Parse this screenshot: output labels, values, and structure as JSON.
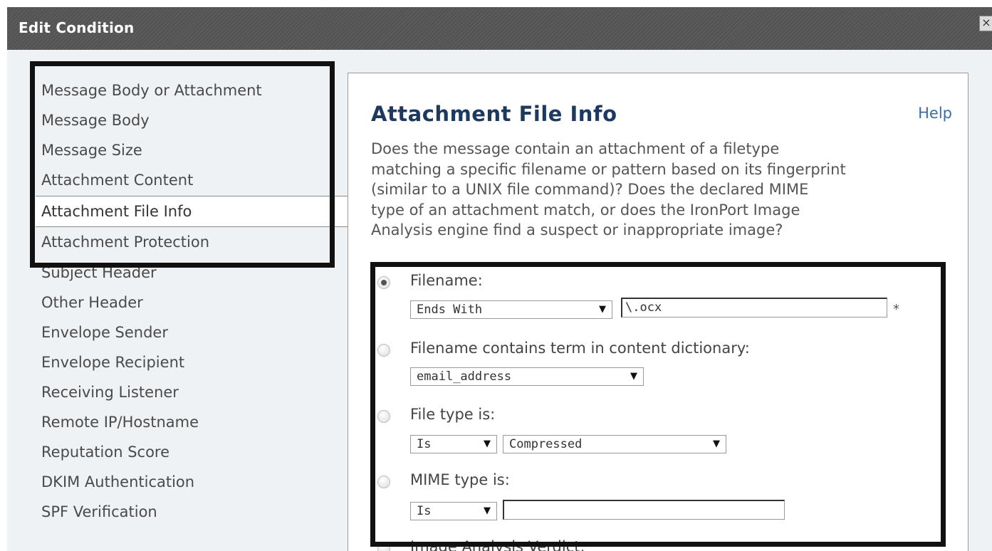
{
  "dialog": {
    "title": "Edit Condition",
    "close_label": "×"
  },
  "conditions": [
    "Message Body or Attachment",
    "Message Body",
    "Message Size",
    "Attachment Content",
    "Attachment File Info",
    "Attachment Protection",
    "Subject Header",
    "Other Header",
    "Envelope Sender",
    "Envelope Recipient",
    "Receiving Listener",
    "Remote IP/Hostname",
    "Reputation Score",
    "DKIM Authentication",
    "SPF Verification"
  ],
  "selected_condition": "Attachment File Info",
  "panel": {
    "title": "Attachment File Info",
    "help": "Help",
    "description_lines": [
      "Does the message contain an attachment of a filetype",
      "matching a specific filename or pattern based on its fingerprint",
      "(similar to a UNIX file command)? Does the declared MIME",
      "type of an attachment match, or does the IronPort Image",
      "Analysis engine find a suspect or inappropriate image?"
    ],
    "options": {
      "filename": {
        "label": "Filename:",
        "operator": "Ends With",
        "value": "\\.ocx",
        "required_mark": "*",
        "checked": true
      },
      "dictionary": {
        "label": "Filename contains term in content dictionary:",
        "dictionary": "email_address"
      },
      "filetype": {
        "label": "File type is:",
        "operator": "Is",
        "type": "Compressed"
      },
      "mime": {
        "label": "MIME type is:",
        "operator": "Is",
        "value": ""
      },
      "image": {
        "label": "Image Analysis Verdict:"
      }
    },
    "dropdown_arrow": "▼"
  }
}
